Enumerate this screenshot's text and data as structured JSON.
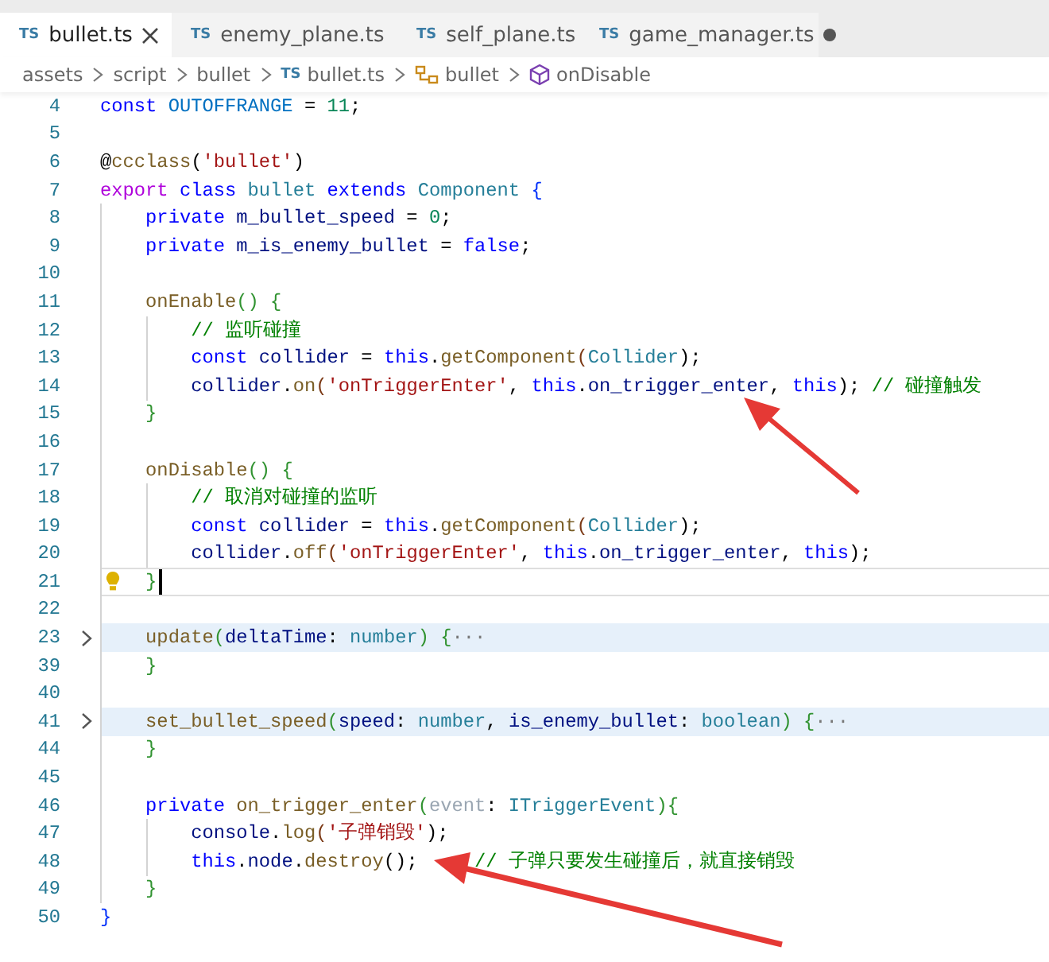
{
  "tabs": [
    {
      "icon_text": "TS",
      "label": "bullet.ts",
      "selected": true,
      "modified": false
    },
    {
      "icon_text": "TS",
      "label": "enemy_plane.ts",
      "selected": false,
      "modified": false
    },
    {
      "icon_text": "TS",
      "label": "self_plane.ts",
      "selected": false,
      "modified": false
    },
    {
      "icon_text": "TS",
      "label": "game_manager.ts",
      "selected": false,
      "modified": true
    }
  ],
  "breadcrumb": [
    {
      "kind": "folder",
      "label": "assets"
    },
    {
      "kind": "folder",
      "label": "script"
    },
    {
      "kind": "folder",
      "label": "bullet"
    },
    {
      "kind": "file",
      "icon_text": "TS",
      "label": "bullet.ts"
    },
    {
      "kind": "class",
      "label": "bullet"
    },
    {
      "kind": "method",
      "label": "onDisable"
    }
  ],
  "lines": [
    {
      "n": "4",
      "folded": false,
      "current": false,
      "lightbulb": false,
      "tokens": [
        {
          "text": "const ",
          "color": "#0000ff"
        },
        {
          "text": "OUTOFFRANGE",
          "color": "#0070c1"
        },
        {
          "text": " = ",
          "color": "#000000"
        },
        {
          "text": "11",
          "color": "#098658"
        },
        {
          "text": ";",
          "color": "#000000"
        }
      ]
    },
    {
      "n": "5",
      "folded": false,
      "current": false,
      "lightbulb": false
    },
    {
      "n": "6",
      "folded": false,
      "current": false,
      "lightbulb": false,
      "tokens": [
        {
          "text": "@",
          "color": "#000000"
        },
        {
          "text": "ccclass",
          "color": "#795e26"
        },
        {
          "text": "(",
          "color": "#000000"
        },
        {
          "text": "'bullet'",
          "color": "#a31515"
        },
        {
          "text": ")",
          "color": "#000000"
        }
      ]
    },
    {
      "n": "7",
      "folded": false,
      "current": false,
      "lightbulb": false,
      "tokens": [
        {
          "text": "export ",
          "color": "#af00db"
        },
        {
          "text": "class ",
          "color": "#0000ff"
        },
        {
          "text": "bullet ",
          "color": "#267f99"
        },
        {
          "text": "extends ",
          "color": "#0000ff"
        },
        {
          "text": "Component",
          "color": "#267f99"
        },
        {
          "text": " {",
          "color": "#0431fa"
        }
      ]
    },
    {
      "n": "8",
      "folded": false,
      "current": false,
      "lightbulb": false,
      "tokens": [
        {
          "text": "    private ",
          "color": "#0000ff"
        },
        {
          "text": "m_bullet_speed",
          "color": "#001080"
        },
        {
          "text": " = ",
          "color": "#000000"
        },
        {
          "text": "0",
          "color": "#098658"
        },
        {
          "text": ";",
          "color": "#000000"
        }
      ]
    },
    {
      "n": "9",
      "folded": false,
      "current": false,
      "lightbulb": false,
      "tokens": [
        {
          "text": "    private ",
          "color": "#0000ff"
        },
        {
          "text": "m_is_enemy_bullet",
          "color": "#001080"
        },
        {
          "text": " = ",
          "color": "#000000"
        },
        {
          "text": "false",
          "color": "#0000ff"
        },
        {
          "text": ";",
          "color": "#000000"
        }
      ]
    },
    {
      "n": "10",
      "folded": false,
      "current": false,
      "lightbulb": false
    },
    {
      "n": "11",
      "folded": false,
      "current": false,
      "lightbulb": false,
      "tokens": [
        {
          "text": "    onEnable",
          "color": "#795e26"
        },
        {
          "text": "() {",
          "color": "#319331"
        }
      ]
    },
    {
      "n": "12",
      "folded": false,
      "current": false,
      "lightbulb": false,
      "tokens": [
        {
          "text": "        // 监听碰撞",
          "color": "#008000"
        }
      ]
    },
    {
      "n": "13",
      "folded": false,
      "current": false,
      "lightbulb": false,
      "tokens": [
        {
          "text": "        const ",
          "color": "#0000ff"
        },
        {
          "text": "collider",
          "color": "#001080"
        },
        {
          "text": " = ",
          "color": "#000000"
        },
        {
          "text": "this",
          "color": "#0000ff"
        },
        {
          "text": ".",
          "color": "#000000"
        },
        {
          "text": "getComponent",
          "color": "#795e26"
        },
        {
          "text": "(",
          "color": "#7b3814"
        },
        {
          "text": "Collider",
          "color": "#267f99"
        },
        {
          "text": ");",
          "color": "#000000"
        }
      ]
    },
    {
      "n": "14",
      "folded": false,
      "current": false,
      "lightbulb": false,
      "tokens": [
        {
          "text": "        collider",
          "color": "#001080"
        },
        {
          "text": ".",
          "color": "#000000"
        },
        {
          "text": "on",
          "color": "#795e26"
        },
        {
          "text": "(",
          "color": "#7b3814"
        },
        {
          "text": "'onTriggerEnter'",
          "color": "#a31515"
        },
        {
          "text": ", ",
          "color": "#000000"
        },
        {
          "text": "this",
          "color": "#0000ff"
        },
        {
          "text": ".",
          "color": "#000000"
        },
        {
          "text": "on_trigger_enter",
          "color": "#001080"
        },
        {
          "text": ", ",
          "color": "#000000"
        },
        {
          "text": "this",
          "color": "#0000ff"
        },
        {
          "text": "); ",
          "color": "#000000"
        },
        {
          "text": "// 碰撞触发",
          "color": "#008000"
        }
      ]
    },
    {
      "n": "15",
      "folded": false,
      "current": false,
      "lightbulb": false,
      "tokens": [
        {
          "text": "    }",
          "color": "#319331"
        }
      ]
    },
    {
      "n": "16",
      "folded": false,
      "current": false,
      "lightbulb": false
    },
    {
      "n": "17",
      "folded": false,
      "current": false,
      "lightbulb": false,
      "tokens": [
        {
          "text": "    onDisable",
          "color": "#795e26"
        },
        {
          "text": "() {",
          "color": "#319331"
        }
      ]
    },
    {
      "n": "18",
      "folded": false,
      "current": false,
      "lightbulb": false,
      "tokens": [
        {
          "text": "        // 取消对碰撞的监听",
          "color": "#008000"
        }
      ]
    },
    {
      "n": "19",
      "folded": false,
      "current": false,
      "lightbulb": false,
      "tokens": [
        {
          "text": "        const ",
          "color": "#0000ff"
        },
        {
          "text": "collider",
          "color": "#001080"
        },
        {
          "text": " = ",
          "color": "#000000"
        },
        {
          "text": "this",
          "color": "#0000ff"
        },
        {
          "text": ".",
          "color": "#000000"
        },
        {
          "text": "getComponent",
          "color": "#795e26"
        },
        {
          "text": "(",
          "color": "#7b3814"
        },
        {
          "text": "Collider",
          "color": "#267f99"
        },
        {
          "text": ");",
          "color": "#000000"
        }
      ]
    },
    {
      "n": "20",
      "folded": false,
      "current": false,
      "lightbulb": false,
      "tokens": [
        {
          "text": "        collider",
          "color": "#001080"
        },
        {
          "text": ".",
          "color": "#000000"
        },
        {
          "text": "off",
          "color": "#795e26"
        },
        {
          "text": "(",
          "color": "#7b3814"
        },
        {
          "text": "'onTriggerEnter'",
          "color": "#a31515"
        },
        {
          "text": ", ",
          "color": "#000000"
        },
        {
          "text": "this",
          "color": "#0000ff"
        },
        {
          "text": ".",
          "color": "#000000"
        },
        {
          "text": "on_trigger_enter",
          "color": "#001080"
        },
        {
          "text": ", ",
          "color": "#000000"
        },
        {
          "text": "this",
          "color": "#0000ff"
        },
        {
          "text": ");",
          "color": "#000000"
        }
      ]
    },
    {
      "n": "21",
      "folded": false,
      "current": true,
      "lightbulb": true,
      "tokens": [
        {
          "text": "    }",
          "color": "#319331"
        }
      ]
    },
    {
      "n": "22",
      "folded": false,
      "current": false,
      "lightbulb": false
    },
    {
      "n": "23",
      "folded": true,
      "current": false,
      "lightbulb": false,
      "tokens": [
        {
          "text": "    update",
          "color": "#795e26"
        },
        {
          "text": "(",
          "color": "#319331"
        },
        {
          "text": "deltaTime",
          "color": "#001080"
        },
        {
          "text": ": ",
          "color": "#000000"
        },
        {
          "text": "number",
          "color": "#267f99"
        },
        {
          "text": ") {",
          "color": "#319331"
        },
        {
          "text": "···",
          "color": "#777777"
        }
      ]
    },
    {
      "n": "39",
      "folded": false,
      "current": false,
      "lightbulb": false,
      "tokens": [
        {
          "text": "    }",
          "color": "#319331"
        }
      ]
    },
    {
      "n": "40",
      "folded": false,
      "current": false,
      "lightbulb": false
    },
    {
      "n": "41",
      "folded": true,
      "current": false,
      "lightbulb": false,
      "tokens": [
        {
          "text": "    set_bullet_speed",
          "color": "#795e26"
        },
        {
          "text": "(",
          "color": "#319331"
        },
        {
          "text": "speed",
          "color": "#001080"
        },
        {
          "text": ": ",
          "color": "#000000"
        },
        {
          "text": "number",
          "color": "#267f99"
        },
        {
          "text": ", ",
          "color": "#000000"
        },
        {
          "text": "is_enemy_bullet",
          "color": "#001080"
        },
        {
          "text": ": ",
          "color": "#000000"
        },
        {
          "text": "boolean",
          "color": "#267f99"
        },
        {
          "text": ") {",
          "color": "#319331"
        },
        {
          "text": "···",
          "color": "#777777"
        }
      ]
    },
    {
      "n": "44",
      "folded": false,
      "current": false,
      "lightbulb": false,
      "tokens": [
        {
          "text": "    }",
          "color": "#319331"
        }
      ]
    },
    {
      "n": "45",
      "folded": false,
      "current": false,
      "lightbulb": false
    },
    {
      "n": "46",
      "folded": false,
      "current": false,
      "lightbulb": false,
      "tokens": [
        {
          "text": "    private ",
          "color": "#0000ff"
        },
        {
          "text": "on_trigger_enter",
          "color": "#795e26"
        },
        {
          "text": "(",
          "color": "#319331"
        },
        {
          "text": "event",
          "color": "#9aa6b2"
        },
        {
          "text": ": ",
          "color": "#000000"
        },
        {
          "text": "ITriggerEvent",
          "color": "#267f99"
        },
        {
          "text": "){",
          "color": "#319331"
        }
      ]
    },
    {
      "n": "47",
      "folded": false,
      "current": false,
      "lightbulb": false,
      "tokens": [
        {
          "text": "        console",
          "color": "#001080"
        },
        {
          "text": ".",
          "color": "#000000"
        },
        {
          "text": "log",
          "color": "#795e26"
        },
        {
          "text": "(",
          "color": "#7b3814"
        },
        {
          "text": "'子弹销毁'",
          "color": "#a31515"
        },
        {
          "text": ");",
          "color": "#000000"
        }
      ]
    },
    {
      "n": "48",
      "folded": false,
      "current": false,
      "lightbulb": false,
      "tokens": [
        {
          "text": "        this",
          "color": "#0000ff"
        },
        {
          "text": ".",
          "color": "#000000"
        },
        {
          "text": "node",
          "color": "#001080"
        },
        {
          "text": ".",
          "color": "#000000"
        },
        {
          "text": "destroy",
          "color": "#795e26"
        },
        {
          "text": "();     ",
          "color": "#000000"
        },
        {
          "text": "// 子弹只要发生碰撞后，就直接销毁",
          "color": "#008000"
        }
      ]
    },
    {
      "n": "49",
      "folded": false,
      "current": false,
      "lightbulb": false,
      "tokens": [
        {
          "text": "    }",
          "color": "#319331"
        }
      ]
    },
    {
      "n": "50",
      "folded": false,
      "current": false,
      "lightbulb": false,
      "tokens": [
        {
          "text": "}",
          "color": "#0431fa"
        }
      ]
    }
  ]
}
